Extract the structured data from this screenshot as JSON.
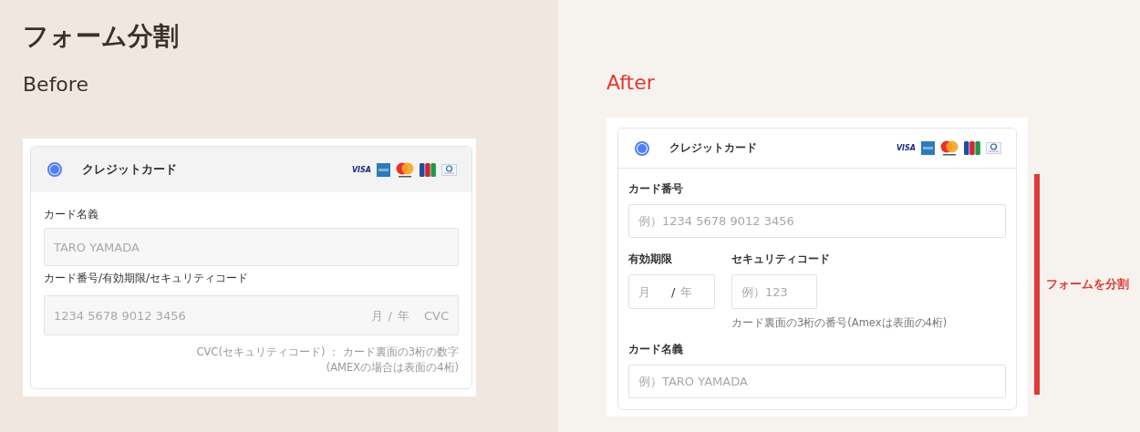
{
  "page_title": "フォーム分割",
  "before": {
    "heading": "Before",
    "card": {
      "title": "クレジットカード",
      "selected": true,
      "brands": [
        {
          "kind": "visa",
          "text": "VISA"
        },
        {
          "kind": "amex"
        },
        {
          "kind": "mastercard"
        },
        {
          "kind": "jcb"
        },
        {
          "kind": "diners"
        }
      ]
    },
    "fields": [
      {
        "kind": "single",
        "label": "カード名義",
        "placeholder": "TARO YAMADA"
      },
      {
        "kind": "combined",
        "label": "カード番号/有効期限/セキュリティコード",
        "placeholder": "1234 5678 9012 3456",
        "month_placeholder": "月",
        "separator": "/",
        "year_placeholder": "年",
        "cvc_placeholder": "CVC"
      }
    ],
    "note_lines": [
      "CVC(セキュリティコード) ： カード裏面の3桁の数字",
      "(AMEXの場合は表面の4桁)"
    ]
  },
  "after": {
    "heading": "After",
    "card": {
      "title": "クレジットカード",
      "selected": true,
      "brands": [
        {
          "kind": "visa",
          "text": "VISA"
        },
        {
          "kind": "amex"
        },
        {
          "kind": "mastercard"
        },
        {
          "kind": "jcb"
        },
        {
          "kind": "diners"
        }
      ]
    },
    "card_number": {
      "label": "カード番号",
      "placeholder": "例）1234 5678 9012 3456"
    },
    "expiry": {
      "label": "有効期限",
      "month_placeholder": "月",
      "separator": "/",
      "year_placeholder": "年"
    },
    "security_code": {
      "label": "セキュリティコード",
      "placeholder": "例）123",
      "hint": "カード裏面の3桁の番号(Amexは表面の4桁)"
    },
    "card_name": {
      "label": "カード名義",
      "placeholder": "例）TARO YAMADA"
    },
    "annotation": "フォームを分割"
  }
}
